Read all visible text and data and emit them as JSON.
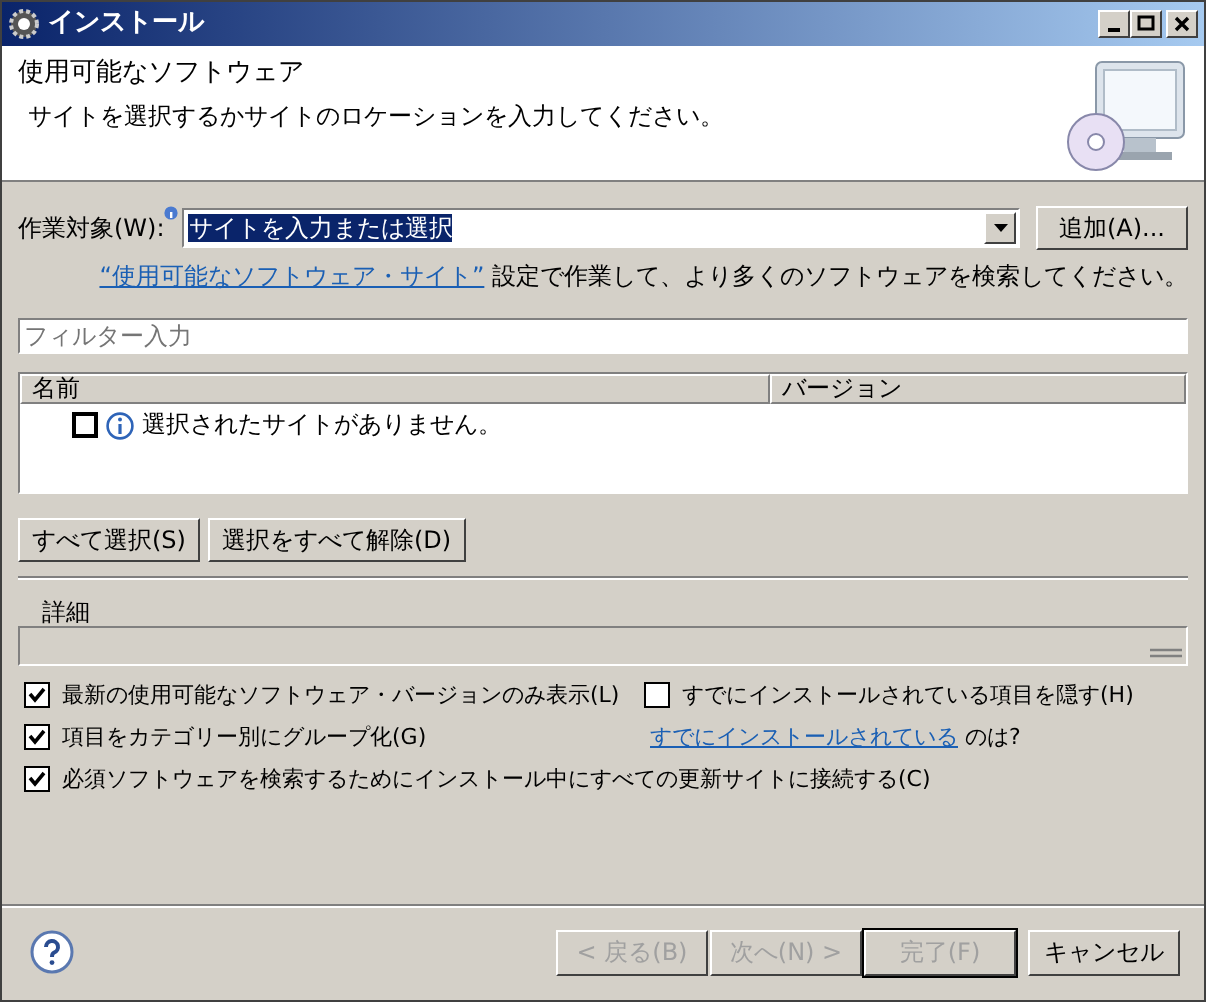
{
  "window": {
    "title": "インストール"
  },
  "header": {
    "title": "使用可能なソフトウェア",
    "description": "サイトを選択するかサイトのロケーションを入力してください。"
  },
  "work_with": {
    "label": "作業対象(W):",
    "value": "サイトを入力または選択",
    "value_selected": true,
    "add_button": "追加(A)..."
  },
  "hint": {
    "link": "“使用可能なソフトウェア・サイト”",
    "text": "設定で作業して、より多くのソフトウェアを検索してください。"
  },
  "filter": {
    "placeholder": "フィルター入力"
  },
  "table": {
    "columns": [
      "名前",
      "バージョン"
    ],
    "rows": [
      {
        "name": "選択されたサイトがありません。",
        "checked": false
      }
    ]
  },
  "selection_buttons": [
    "すべて選択(S)",
    "選択をすべて解除(D)"
  ],
  "details": {
    "label": "詳細"
  },
  "options": [
    {
      "label": "最新の使用可能なソフトウェア・バージョンのみ表示(L)",
      "checked": true
    },
    {
      "label": "すでにインストールされている項目を隠す(H)",
      "checked": false
    },
    {
      "label": "項目をカテゴリー別にグループ化(G)",
      "checked": true
    },
    {
      "label": "必須ソフトウェアを検索するためにインストール中にすべての更新サイトに接続する(C)",
      "checked": true
    }
  ],
  "installed_hint": {
    "link": "すでにインストールされている",
    "text": "のは?"
  },
  "footer_buttons": [
    {
      "label": "< 戻る(B)",
      "disabled": true,
      "default": false
    },
    {
      "label": "次へ(N) >",
      "disabled": true,
      "default": false
    },
    {
      "label": "完了(F)",
      "disabled": true,
      "default": true
    },
    {
      "label": "キャンセル",
      "disabled": false,
      "default": false
    }
  ]
}
